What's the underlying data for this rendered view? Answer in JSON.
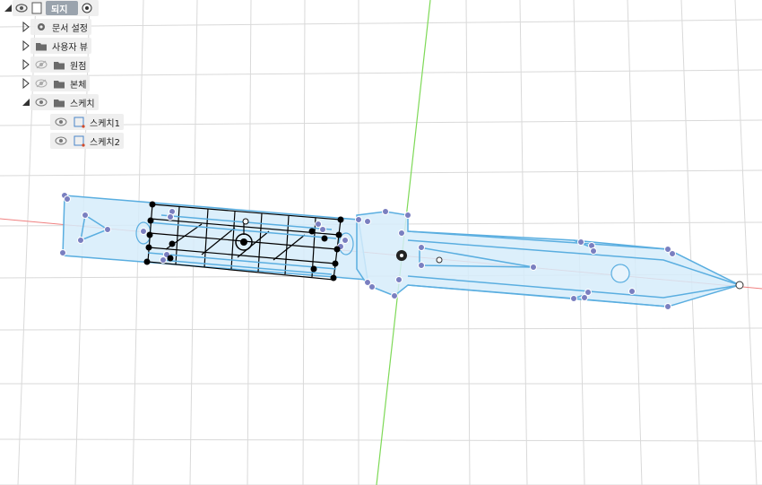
{
  "browser": {
    "root": {
      "label": "(저장되지 않음)"
    },
    "items": [
      {
        "label": "문서 설정",
        "icon": "gear-icon"
      },
      {
        "label": "사용자 뷰",
        "icon": "folder-icon"
      },
      {
        "label": "원점",
        "icon": "folder-icon"
      },
      {
        "label": "본체",
        "icon": "folder-icon"
      },
      {
        "label": "스케치",
        "icon": "folder-icon"
      }
    ],
    "sketches": [
      {
        "label": "스케치1"
      },
      {
        "label": "스케치2"
      }
    ]
  },
  "colors": {
    "grid": "#d9d9d9",
    "x_axis": "#f08080",
    "z_axis": "#7ed957",
    "profile_fill": "#d6ecfa",
    "sketch_line": "#5aaee0",
    "point": "#7a7fc0",
    "construction": "#000000"
  }
}
